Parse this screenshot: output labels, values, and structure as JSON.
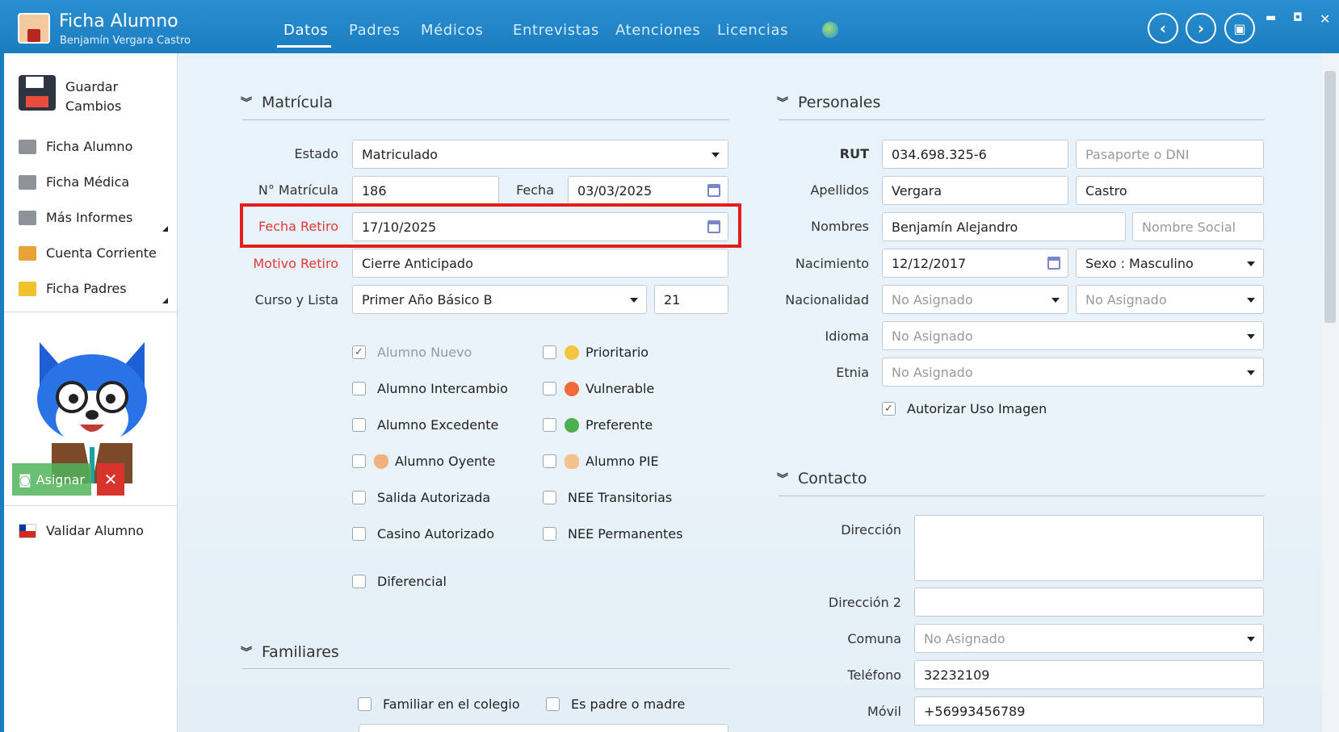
{
  "window": {
    "title": "Ficha Alumno",
    "subtitle": "Benjamín Vergara Castro"
  },
  "tabs": [
    {
      "label": "Datos"
    },
    {
      "label": "Padres"
    },
    {
      "label": "Médicos"
    },
    {
      "label": "Entrevistas"
    },
    {
      "label": "Atenciones"
    },
    {
      "label": "Licencias"
    }
  ],
  "sidebar": {
    "save": "Guardar Cambios",
    "items": [
      {
        "label": "Ficha Alumno"
      },
      {
        "label": "Ficha Médica"
      },
      {
        "label": "Más Informes"
      },
      {
        "label": "Cuenta Corriente"
      },
      {
        "label": "Ficha Padres"
      }
    ],
    "assign": "Asignar",
    "validate": "Validar Alumno"
  },
  "matricula": {
    "title": "Matrícula",
    "estado_label": "Estado",
    "estado": "Matriculado",
    "numero_label": "N° Matrícula",
    "numero": "186",
    "fecha_label": "Fecha",
    "fecha": "03/03/2025",
    "retiro_label": "Fecha Retiro",
    "retiro": "17/10/2025",
    "motivo_label": "Motivo Retiro",
    "motivo": "Cierre Anticipado",
    "curso_label": "Curso y Lista",
    "curso": "Primer Año Básico B",
    "lista": "21",
    "checks": {
      "nuevo": "Alumno Nuevo",
      "intercambio": "Alumno Intercambio",
      "excedente": "Alumno Excedente",
      "oyente": "Alumno Oyente",
      "salida": "Salida Autorizada",
      "casino": "Casino Autorizado",
      "diferencial": "Diferencial",
      "prioritario": "Prioritario",
      "vulnerable": "Vulnerable",
      "preferente": "Preferente",
      "pie": "Alumno PIE",
      "nee_t": "NEE Transitorias",
      "nee_p": "NEE Permanentes"
    }
  },
  "familiares": {
    "title": "Familiares",
    "colegio": "Familiar en el colegio",
    "padre": "Es padre o madre"
  },
  "personales": {
    "title": "Personales",
    "rut_label": "RUT",
    "rut": "034.698.325-6",
    "pasaporte_ph": "Pasaporte o DNI",
    "apellidos_label": "Apellidos",
    "apellido1": "Vergara",
    "apellido2": "Castro",
    "nombres_label": "Nombres",
    "nombres": "Benjamín Alejandro",
    "social_ph": "Nombre Social",
    "nacimiento_label": "Nacimiento",
    "nacimiento": "12/12/2017",
    "sexo": "Sexo : Masculino",
    "nacionalidad_label": "Nacionalidad",
    "nacionalidad1": "No Asignado",
    "nacionalidad2": "No Asignado",
    "idioma_label": "Idioma",
    "idioma": "No Asignado",
    "etnia_label": "Etnia",
    "etnia": "No Asignado",
    "imagen": "Autorizar Uso Imagen"
  },
  "contacto": {
    "title": "Contacto",
    "direccion_label": "Dirección",
    "direccion": "",
    "direccion2_label": "Dirección 2",
    "direccion2": "",
    "comuna_label": "Comuna",
    "comuna": "No Asignado",
    "telefono_label": "Teléfono",
    "telefono": "32232109",
    "movil_label": "Móvil",
    "movil": "+56993456789"
  },
  "colors": {
    "titlebar": "#1a7dbf",
    "highlight": "#e31c1c",
    "required_label": "#e53935"
  }
}
